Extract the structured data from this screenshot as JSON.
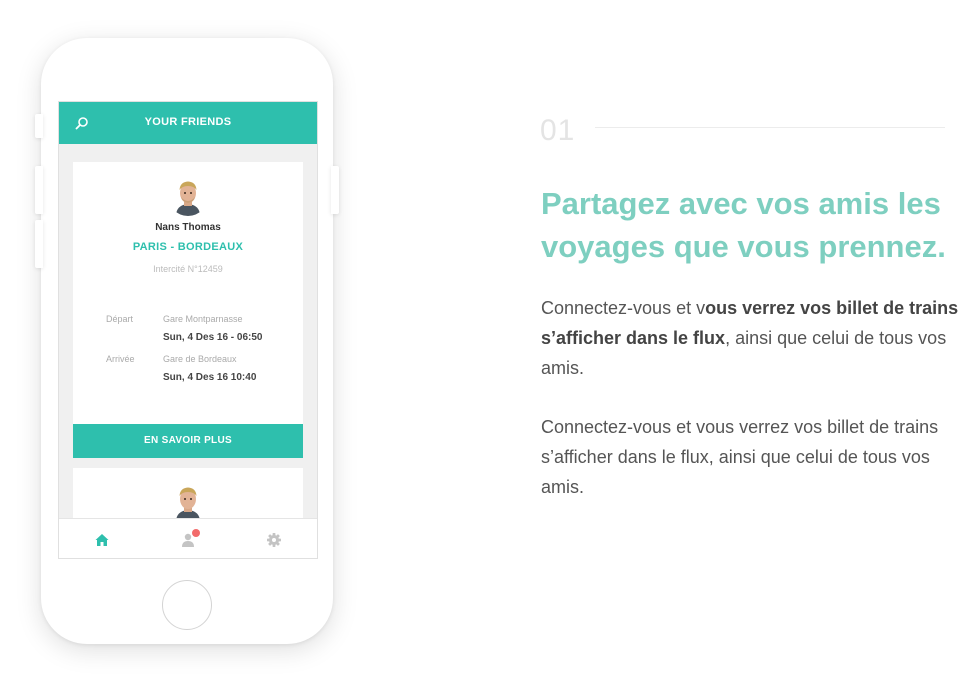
{
  "colors": {
    "accent": "#2ebfad",
    "headline": "#7ecfc0",
    "badge": "#f26b6b"
  },
  "app": {
    "header_title": "YOUR FRIENDS",
    "icons": {
      "search": "search-icon",
      "home": "home-icon",
      "friends": "person-icon",
      "settings": "gear-icon"
    },
    "card": {
      "name": "Nans Thomas",
      "route": "PARIS - BORDEAUX",
      "train": "Intercité N°12459",
      "departure_label": "Départ",
      "departure_station": "Gare Montparnasse",
      "departure_time": "Sun, 4 Des 16 - 06:50",
      "arrival_label": "Arrivée",
      "arrival_station": "Gare de Bordeaux",
      "arrival_time": "Sun, 4 Des 16 10:40"
    },
    "more_button": "EN SAVOIR PLUS"
  },
  "section": {
    "number": "01",
    "headline": "Partagez avec vos amis les voyages que vous prennez.",
    "para1": {
      "part1": "Connectez-vous et v",
      "bold": "ous verrez vos billet de trains s’afficher dans le flux",
      "part2": ", ainsi que celui de tous vos amis."
    },
    "para2": "Connectez-vous et vous verrez vos billet de trains s’afficher dans le flux, ainsi que celui de tous vos amis."
  }
}
